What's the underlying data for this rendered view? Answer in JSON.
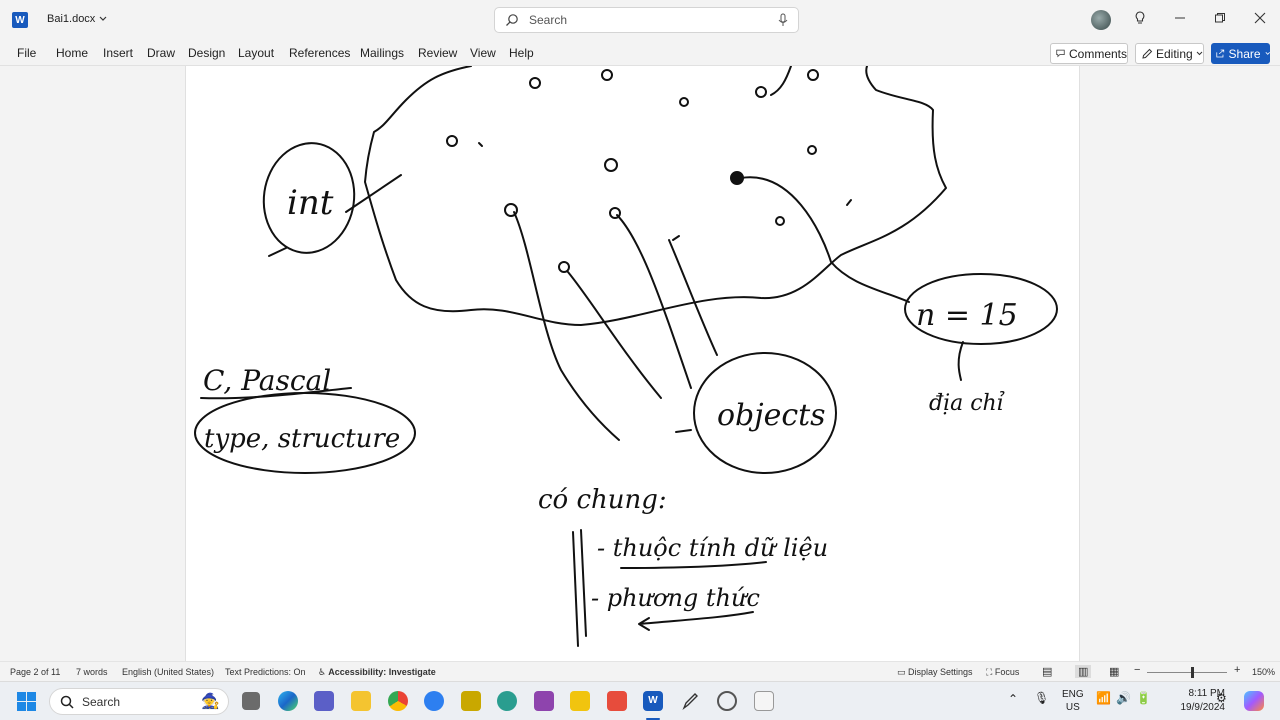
{
  "titlebar": {
    "doc_name": "Bai1.docx",
    "search_placeholder": "Search"
  },
  "menu": {
    "items": [
      "File",
      "Home",
      "Insert",
      "Draw",
      "Design",
      "Layout",
      "References",
      "Mailings",
      "Review",
      "View",
      "Help"
    ],
    "comments_label": "Comments",
    "editing_label": "Editing",
    "share_label": "Share"
  },
  "ink_text": {
    "int": "int",
    "c_pascal": "C, Pascal",
    "type_structure": "type, structure",
    "objects": "objects",
    "n15": "n = 15",
    "dia_chi": "địa chỉ",
    "co_chung": "có chung:",
    "thuoc_tinh": "- thuộc tính dữ liệu",
    "phuong_thuc": "- phương thức"
  },
  "status": {
    "page": "Page 2 of 11",
    "words": "7 words",
    "language": "English (United States)",
    "predictions": "Text Predictions: On",
    "accessibility": "Accessibility: Investigate",
    "display_settings": "Display Settings",
    "focus": "Focus",
    "zoom": "150%"
  },
  "taskbar": {
    "search_label": "Search",
    "lang_top": "ENG",
    "lang_bottom": "US",
    "time": "8:11 PM",
    "date": "19/9/2024"
  },
  "colors": {
    "accent": "#185abd",
    "ink": "#111111"
  }
}
